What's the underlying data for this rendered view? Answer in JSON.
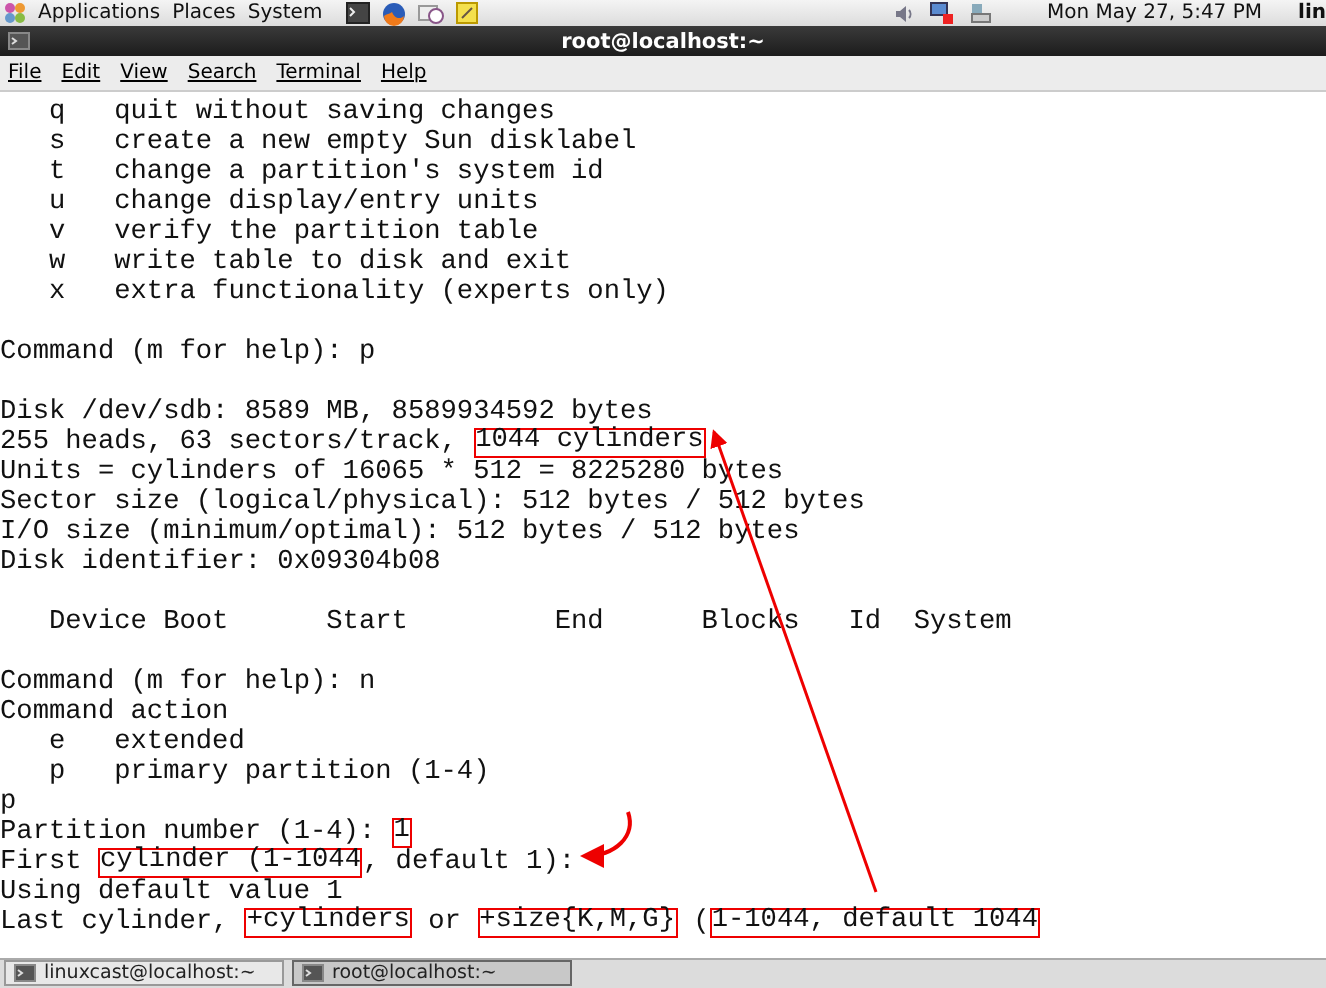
{
  "top_panel": {
    "menus": [
      "Applications",
      "Places",
      "System"
    ],
    "clock": "Mon May 27,  5:47 PM",
    "user": "lin"
  },
  "window": {
    "title": "root@localhost:~"
  },
  "menu_bar": [
    "File",
    "Edit",
    "View",
    "Search",
    "Terminal",
    "Help"
  ],
  "terminal": {
    "lines": [
      {
        "kind": "text",
        "segments": [
          {
            "text": "   q   quit without saving changes",
            "boxed": false
          }
        ]
      },
      {
        "kind": "text",
        "segments": [
          {
            "text": "   s   create a new empty Sun disklabel",
            "boxed": false
          }
        ]
      },
      {
        "kind": "text",
        "segments": [
          {
            "text": "   t   change a partition's system id",
            "boxed": false
          }
        ]
      },
      {
        "kind": "text",
        "segments": [
          {
            "text": "   u   change display/entry units",
            "boxed": false
          }
        ]
      },
      {
        "kind": "text",
        "segments": [
          {
            "text": "   v   verify the partition table",
            "boxed": false
          }
        ]
      },
      {
        "kind": "text",
        "segments": [
          {
            "text": "   w   write table to disk and exit",
            "boxed": false
          }
        ]
      },
      {
        "kind": "text",
        "segments": [
          {
            "text": "   x   extra functionality (experts only)",
            "boxed": false
          }
        ]
      },
      {
        "kind": "blank"
      },
      {
        "kind": "text",
        "segments": [
          {
            "text": "Command (m for help): p",
            "boxed": false
          }
        ]
      },
      {
        "kind": "blank"
      },
      {
        "kind": "text",
        "segments": [
          {
            "text": "Disk /dev/sdb: 8589 MB, 8589934592 bytes",
            "boxed": false
          }
        ]
      },
      {
        "kind": "text",
        "segments": [
          {
            "text": "255 heads, 63 sectors/track, ",
            "boxed": false
          },
          {
            "text": "1044 cylinders",
            "boxed": true
          }
        ]
      },
      {
        "kind": "text",
        "segments": [
          {
            "text": "Units = cylinders of 16065 * 512 = 8225280 bytes",
            "boxed": false
          }
        ]
      },
      {
        "kind": "text",
        "segments": [
          {
            "text": "Sector size (logical/physical): 512 bytes / 512 bytes",
            "boxed": false
          }
        ]
      },
      {
        "kind": "text",
        "segments": [
          {
            "text": "I/O size (minimum/optimal): 512 bytes / 512 bytes",
            "boxed": false
          }
        ]
      },
      {
        "kind": "text",
        "segments": [
          {
            "text": "Disk identifier: 0x09304b08",
            "boxed": false
          }
        ]
      },
      {
        "kind": "blank"
      },
      {
        "kind": "text",
        "segments": [
          {
            "text": "   Device Boot      Start         End      Blocks   Id  System",
            "boxed": false
          }
        ]
      },
      {
        "kind": "blank"
      },
      {
        "kind": "text",
        "segments": [
          {
            "text": "Command (m for help): n",
            "boxed": false
          }
        ]
      },
      {
        "kind": "text",
        "segments": [
          {
            "text": "Command action",
            "boxed": false
          }
        ]
      },
      {
        "kind": "text",
        "segments": [
          {
            "text": "   e   extended",
            "boxed": false
          }
        ]
      },
      {
        "kind": "text",
        "segments": [
          {
            "text": "   p   primary partition (1-4)",
            "boxed": false
          }
        ]
      },
      {
        "kind": "text",
        "segments": [
          {
            "text": "p",
            "boxed": false
          }
        ]
      },
      {
        "kind": "text",
        "segments": [
          {
            "text": "Partition number (1-4): ",
            "boxed": false
          },
          {
            "text": "1",
            "boxed": true
          }
        ]
      },
      {
        "kind": "text",
        "segments": [
          {
            "text": "First ",
            "boxed": false
          },
          {
            "text": "cylinder (1-1044",
            "boxed": true
          },
          {
            "text": ", default 1):",
            "boxed": false
          }
        ]
      },
      {
        "kind": "text",
        "segments": [
          {
            "text": "Using default value 1",
            "boxed": false
          }
        ]
      },
      {
        "kind": "text",
        "segments": [
          {
            "text": "Last cylinder, ",
            "boxed": false
          },
          {
            "text": "+cylinders",
            "boxed": true
          },
          {
            "text": " or ",
            "boxed": false
          },
          {
            "text": "+size{K,M,G}",
            "boxed": true
          },
          {
            "text": " (",
            "boxed": false
          },
          {
            "text": "1-1044, default 1044",
            "boxed": true
          }
        ]
      }
    ]
  },
  "taskbar": [
    {
      "label": "linuxcast@localhost:~",
      "selected": false
    },
    {
      "label": "root@localhost:~",
      "selected": true
    }
  ]
}
